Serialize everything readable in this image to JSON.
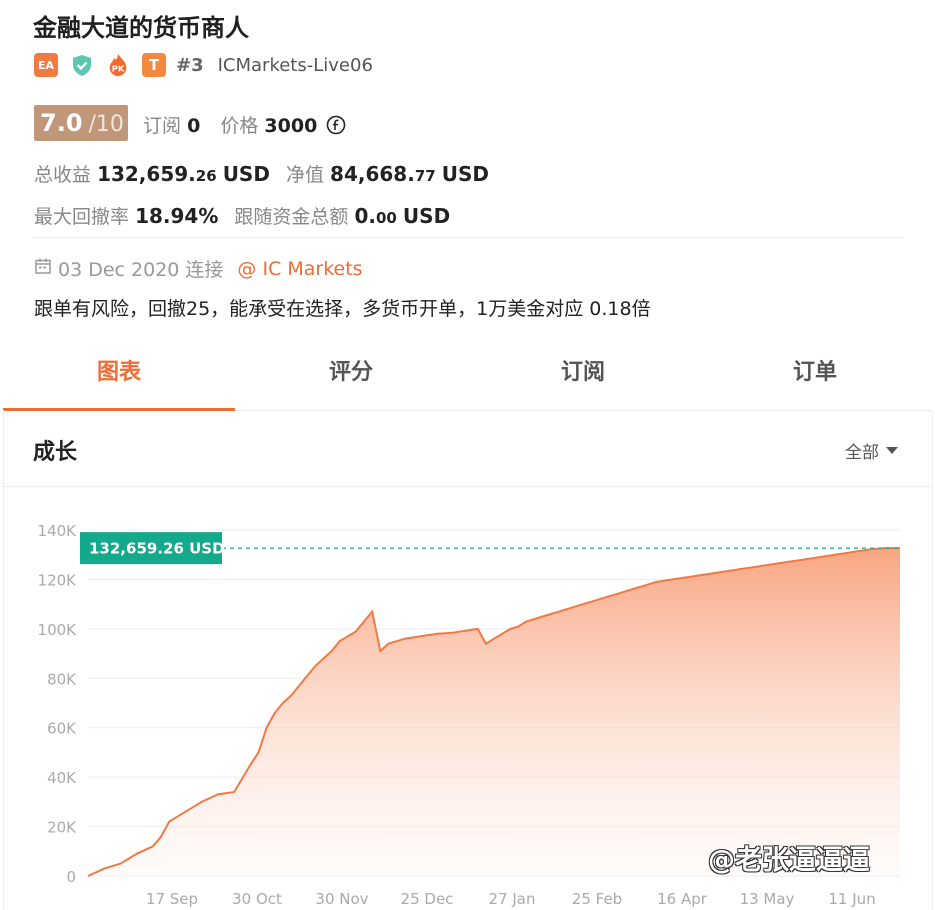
{
  "header": {
    "title": "金融大道的货币商人",
    "badges": {
      "ea": "EA",
      "pk": "PK",
      "t": "T"
    },
    "rank": "#3",
    "broker": "ICMarkets-Live06"
  },
  "rating": {
    "score": "7.0",
    "denominator": "/10",
    "subscribe_label": "订阅",
    "subscribe_count": "0",
    "price_label": "价格",
    "price_value": "3000"
  },
  "stats": {
    "total_profit_label": "总收益",
    "total_profit_int": "132,659.",
    "total_profit_dec": "26",
    "total_profit_unit": "USD",
    "equity_label": "净值",
    "equity_int": "84,668.",
    "equity_dec": "77",
    "equity_unit": "USD",
    "max_drawdown_label": "最大回撤率",
    "max_drawdown_value": "18.94%",
    "follow_total_label": "跟随资金总额",
    "follow_total_int": "0.",
    "follow_total_dec": "00",
    "follow_total_unit": "USD"
  },
  "meta": {
    "date": "03 Dec 2020 连接",
    "broker_link": "@ IC Markets",
    "description": "跟单有风险，回撤25，能承受在选择，多货币开单，1万美金对应 0.18倍"
  },
  "tabs": [
    {
      "label": "图表",
      "active": true
    },
    {
      "label": "评分",
      "active": false
    },
    {
      "label": "订阅",
      "active": false
    },
    {
      "label": "订单",
      "active": false
    }
  ],
  "section": {
    "title": "成长",
    "filter": "全部"
  },
  "colors": {
    "accent": "#f06b35",
    "line": "#f07a45",
    "tag": "#13a98a",
    "score_bg": "#c1977a"
  },
  "chart_data": {
    "type": "area",
    "current_label": "132,659.26 USD",
    "current_value": 132659.26,
    "y_ticks": [
      "0",
      "20K",
      "40K",
      "60K",
      "80K",
      "100K",
      "120K",
      "140K"
    ],
    "ylim": [
      0,
      140000
    ],
    "x_ticks": [
      "17 Sep",
      "30 Oct",
      "30 Nov",
      "25 Dec",
      "27 Jan",
      "25 Feb",
      "16 Apr",
      "13 May",
      "11 Jun"
    ],
    "x": [
      0,
      2,
      4,
      6,
      8,
      9,
      10,
      11,
      12,
      13,
      14,
      16,
      18,
      20,
      21,
      22,
      23,
      24,
      25,
      26,
      27,
      28,
      29,
      30,
      31,
      32,
      33,
      34,
      35,
      36,
      37,
      38,
      39,
      40,
      41,
      42,
      43,
      44,
      45,
      46,
      47,
      48,
      49,
      50,
      51,
      52,
      53,
      54,
      55,
      56,
      57,
      58,
      59,
      60,
      61,
      62,
      63,
      64,
      65,
      66,
      67,
      68,
      69,
      70,
      72,
      74,
      76,
      78,
      80,
      82,
      84,
      86,
      88,
      90,
      92,
      94,
      96,
      98,
      100
    ],
    "values": [
      0,
      3000,
      5000,
      9000,
      12000,
      16000,
      22000,
      24000,
      26000,
      28000,
      30000,
      33000,
      34000,
      45000,
      50000,
      60000,
      66000,
      70000,
      73000,
      77000,
      81000,
      85000,
      88000,
      91000,
      95000,
      97000,
      99000,
      103000,
      107000,
      91000,
      94000,
      95000,
      96000,
      96500,
      97000,
      97500,
      98000,
      98200,
      98500,
      99000,
      99500,
      100000,
      94000,
      96000,
      98000,
      100000,
      101000,
      103000,
      104000,
      105000,
      106000,
      107000,
      108000,
      109000,
      110000,
      111000,
      112000,
      113000,
      114000,
      115000,
      116000,
      117000,
      118000,
      119000,
      120000,
      121000,
      122000,
      123000,
      124000,
      125000,
      126000,
      127000,
      128000,
      129000,
      130000,
      131000,
      132000,
      132659,
      132659
    ],
    "grid": true
  },
  "watermark": "@老张逼逼逼"
}
